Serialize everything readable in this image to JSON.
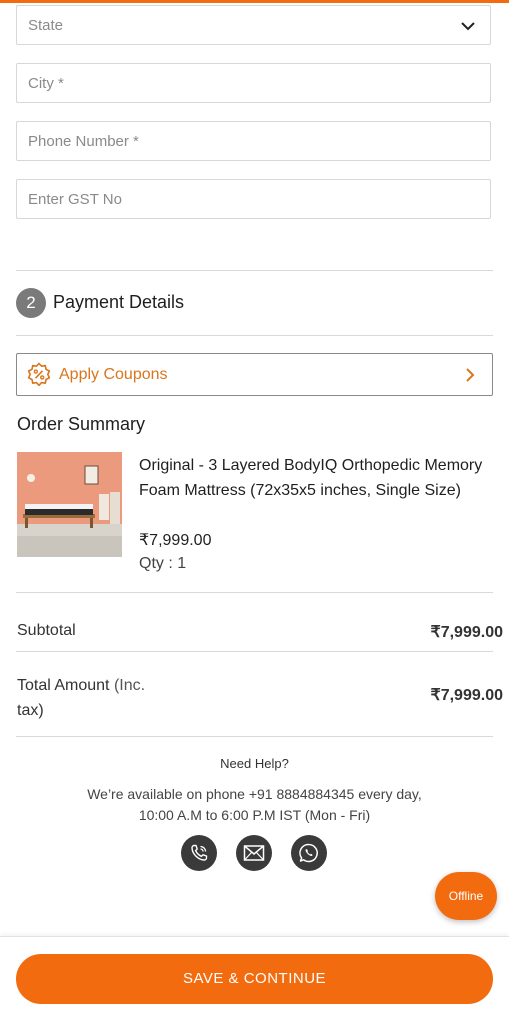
{
  "form": {
    "state_placeholder": "State",
    "city_placeholder": "City *",
    "phone_placeholder": "Phone Number *",
    "gst_placeholder": "Enter GST No"
  },
  "payment": {
    "step_number": "2",
    "title": "Payment Details"
  },
  "coupon": {
    "label": "Apply Coupons"
  },
  "order": {
    "title": "Order Summary",
    "product_name": "Original - 3 Layered BodyIQ Orthopedic Memory Foam Mattress (72x35x5 inches, Single Size)",
    "product_price": "₹7,999.00",
    "product_qty": "Qty : 1"
  },
  "summary": {
    "subtotal_label": "Subtotal",
    "subtotal_value": "₹7,999.00",
    "total_label_main": "Total Amount",
    "total_label_suffix": "(Inc.",
    "total_label_suffix2": "tax)",
    "total_value": "₹7,999.00"
  },
  "help": {
    "title": "Need Help?",
    "line1": "We’re available on phone +91 8884884345 every day,",
    "line2": "10:00 A.M to 6:00 P.M IST (Mon - Fri)"
  },
  "contact_icons": [
    "phone-icon",
    "mail-icon",
    "whatsapp-icon"
  ],
  "offline_label": "Offline",
  "save_button_label": "SAVE & CONTINUE",
  "colors": {
    "accent": "#f26b0f",
    "coupon_text": "#d9761c",
    "icon_circle": "#3a3a3a"
  }
}
